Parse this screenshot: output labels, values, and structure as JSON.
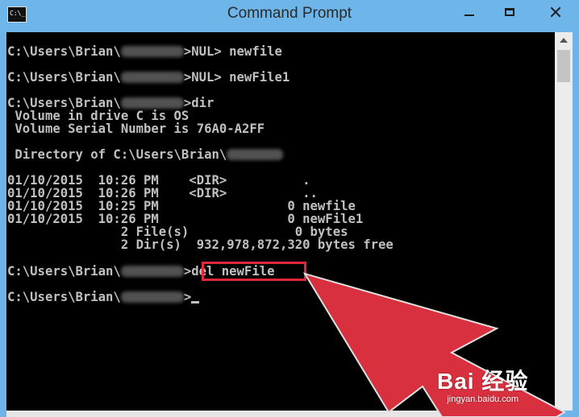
{
  "window": {
    "title": "Command Prompt",
    "icon": "cmd-icon",
    "icon_text": "C:\\_"
  },
  "console": {
    "lines": [
      {
        "prefix": "C:\\Users\\Brian\\",
        "suffix": ">NUL> newfile"
      },
      {
        "prefix": "C:\\Users\\Brian\\",
        "suffix": ">NUL> newFile1"
      },
      {
        "prefix": "C:\\Users\\Brian\\",
        "suffix": ">dir"
      },
      {
        "text": " Volume in drive C is OS"
      },
      {
        "text": " Volume Serial Number is 76A0-A2FF"
      },
      {
        "text": " Directory of C:\\Users\\Brian\\"
      },
      {
        "text": "01/10/2015  10:26 PM    <DIR>          ."
      },
      {
        "text": "01/10/2015  10:26 PM    <DIR>          .."
      },
      {
        "text": "01/10/2015  10:25 PM                 0 newfile"
      },
      {
        "text": "01/10/2015  10:26 PM                 0 newFile1"
      },
      {
        "text": "               2 File(s)              0 bytes"
      },
      {
        "text": "               2 Dir(s)  932,978,872,320 bytes free"
      },
      {
        "prefix": "C:\\Users\\Brian\\",
        "suffix": ">del newFile"
      },
      {
        "prefix": "C:\\Users\\Brian\\",
        "suffix": ">"
      }
    ],
    "highlighted_command": "del newFile"
  },
  "colors": {
    "titlebar": "#6eb5ea",
    "console_bg": "#000000",
    "console_text": "#c0c0c0",
    "highlight": "#e0283a",
    "arrow": "#d9303f"
  },
  "watermark": {
    "brand": "Bai 经验",
    "url": "jingyan.baidu.com"
  }
}
